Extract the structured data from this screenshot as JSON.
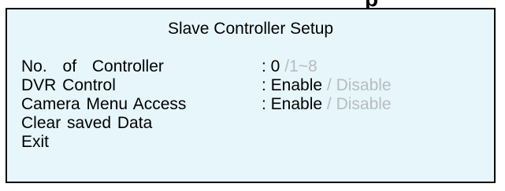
{
  "top_fragment": {
    "glyph": "p"
  },
  "dialog": {
    "title": "Slave Controller Setup",
    "items": [
      {
        "label": "No. of Controller",
        "prefix": ": ",
        "selected": "0",
        "separator": "",
        "alternate": "/1~8"
      },
      {
        "label": "DVR Control",
        "prefix": ": ",
        "selected": "Enable",
        "separator": " / ",
        "alternate": "Disable"
      },
      {
        "label": "Camera Menu Access",
        "prefix": ": ",
        "selected": "Enable",
        "separator": " / ",
        "alternate": "Disable"
      },
      {
        "label": "Clear saved Data"
      },
      {
        "label": "Exit"
      }
    ]
  },
  "colors": {
    "panel_background": "#e6f6fb",
    "border": "#000000",
    "text": "#000000",
    "inactive_option": "#b8bcbf"
  }
}
